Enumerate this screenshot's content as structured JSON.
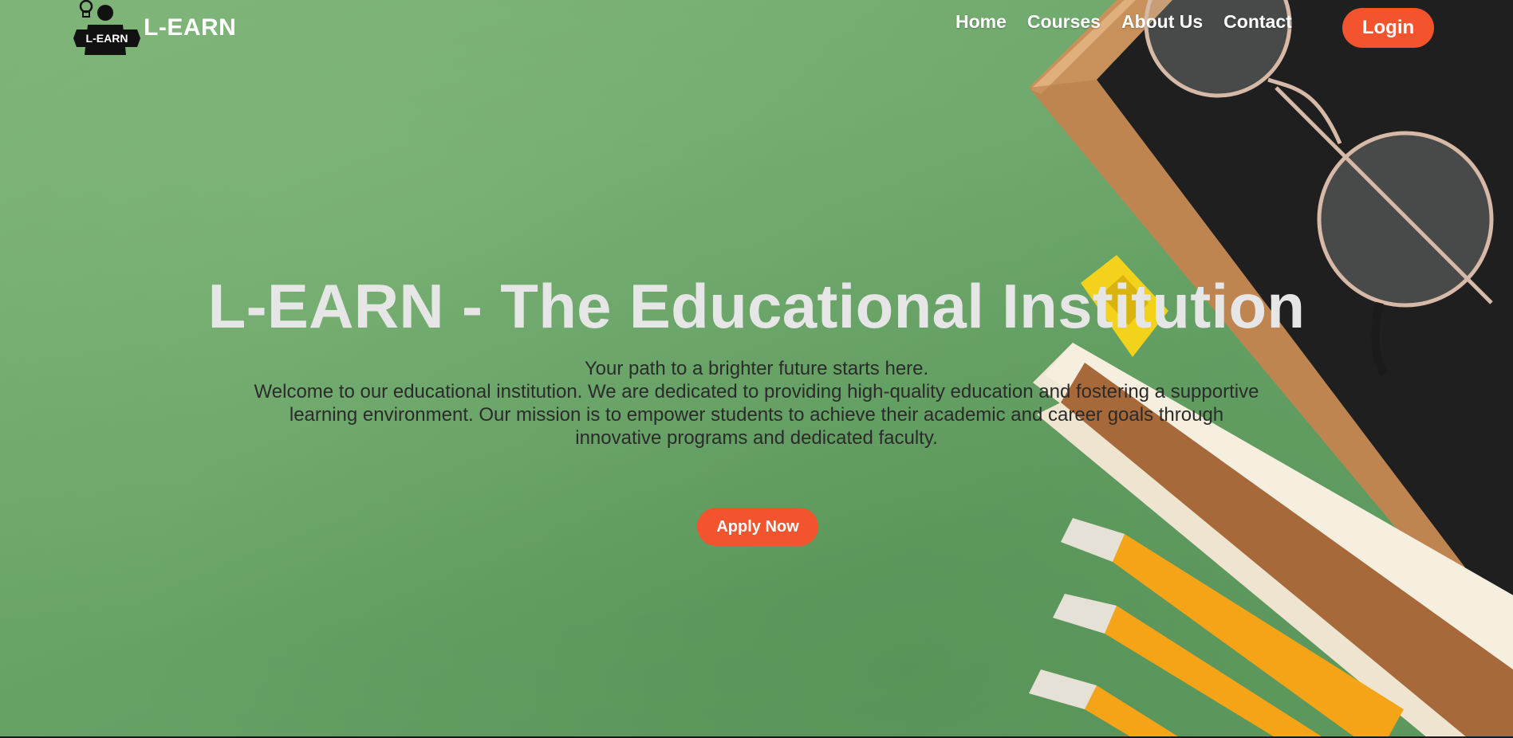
{
  "brand": {
    "logo_text": "L-EARN",
    "name": "L-EARN",
    "logo_icon": "student-with-lightbulb-icon"
  },
  "nav": {
    "links": [
      {
        "label": "Home"
      },
      {
        "label": "Courses"
      },
      {
        "label": "About Us"
      },
      {
        "label": "Contact"
      }
    ],
    "login_label": "Login"
  },
  "hero": {
    "title": "L-EARN - The Educational Institution",
    "tagline": "Your path to a brighter future starts here.",
    "description": "Welcome to our educational institution. We are dedicated to providing high-quality education and fostering a supportive learning environment. Our mission is to empower students to achieve their academic and career goals through innovative programs and dedicated faculty.",
    "apply_label": "Apply Now",
    "background_image": "chalkboard-glasses-pencils-ruler-on-green"
  },
  "colors": {
    "accent": "#f4542d",
    "background": "#6fa86d",
    "title": "#e6e6e6",
    "text": "#2b2b2b"
  }
}
